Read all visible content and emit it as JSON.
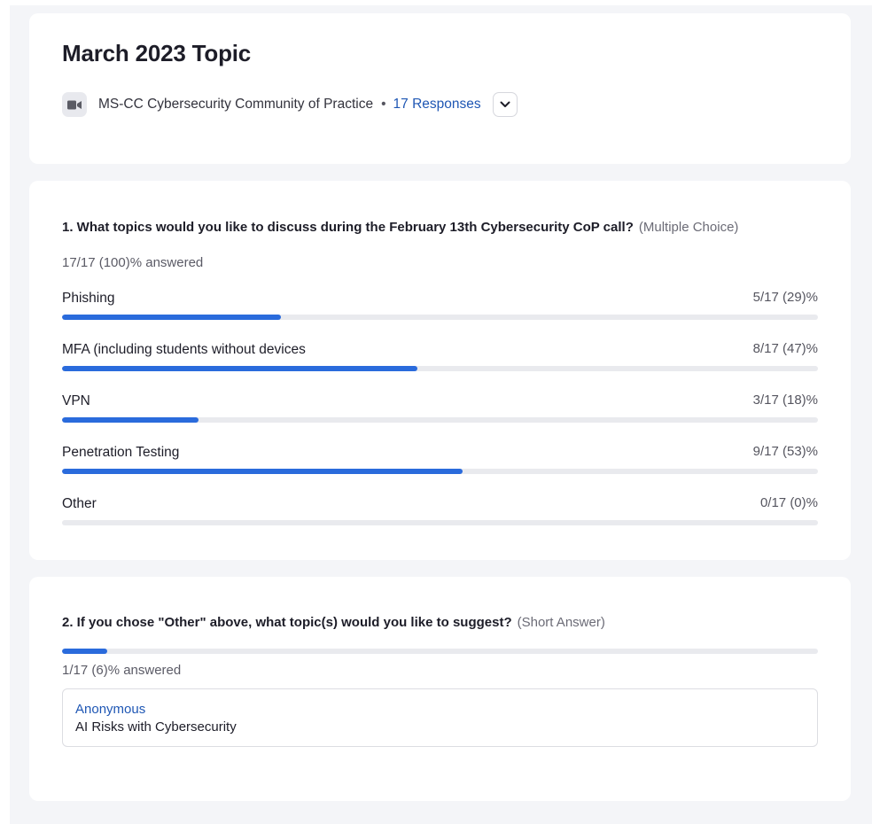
{
  "header": {
    "title": "March 2023 Topic",
    "meeting_icon": "video-camera-icon",
    "meeting_name": "MS-CC Cybersecurity Community of Practice",
    "separator": "•",
    "responses_link": "17 Responses",
    "toggle_icon": "chevron-down-icon"
  },
  "questions": [
    {
      "title": "1. What topics would you like to discuss during the February 13th Cybersecurity CoP call?",
      "type": "(Multiple Choice)",
      "answered_text": "17/17 (100)% answered",
      "options": [
        {
          "label": "Phishing",
          "stat": "5/17 (29)%",
          "fraction": 0.29
        },
        {
          "label": "MFA (including students without devices",
          "stat": "8/17 (47)%",
          "fraction": 0.47
        },
        {
          "label": "VPN",
          "stat": "3/17 (18)%",
          "fraction": 0.18
        },
        {
          "label": "Penetration Testing",
          "stat": "9/17 (53)%",
          "fraction": 0.53
        },
        {
          "label": "Other",
          "stat": "0/17 (0)%",
          "fraction": 0
        }
      ]
    },
    {
      "title": "2. If you chose \"Other\" above, what topic(s) would you like to suggest?",
      "type": "(Short Answer)",
      "answered_fraction": 0.06,
      "answered_text": "1/17 (6)% answered",
      "responses": [
        {
          "author": "Anonymous",
          "text": "AI Risks with Cybersecurity"
        }
      ]
    }
  ],
  "colors": {
    "accent": "#2a6bdc",
    "link": "#1f57b4",
    "track": "#e9eaee",
    "page_background": "#f4f5f8"
  }
}
